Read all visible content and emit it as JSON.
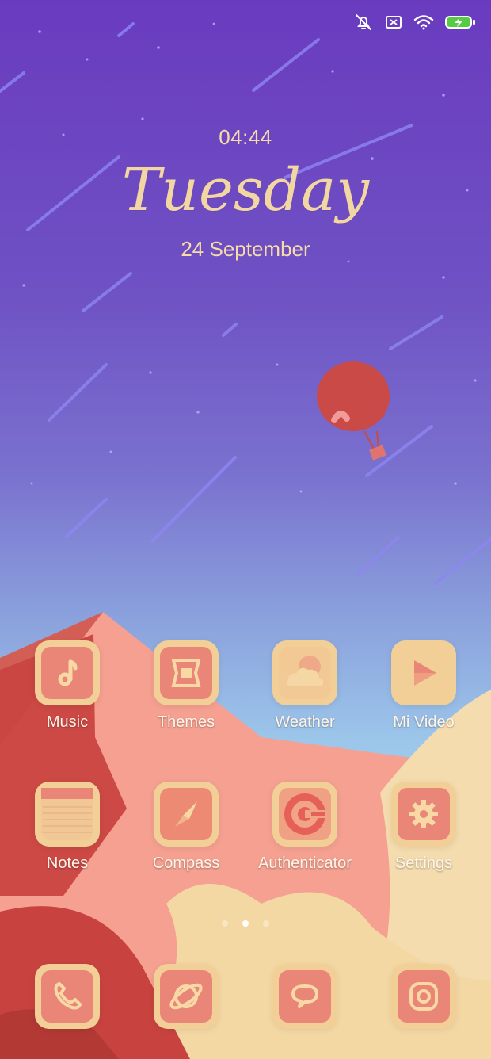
{
  "status_bar": {
    "icons": [
      "notifications-muted-icon",
      "no-sim-icon",
      "wifi-icon",
      "battery-charging-icon"
    ]
  },
  "lockclock": {
    "time": "04:44",
    "day": "Tuesday",
    "date": "24 September"
  },
  "apps": [
    {
      "label": "Music",
      "icon": "music-note-icon"
    },
    {
      "label": "Themes",
      "icon": "themes-icon"
    },
    {
      "label": "Weather",
      "icon": "weather-icon"
    },
    {
      "label": "Mi Video",
      "icon": "play-icon"
    },
    {
      "label": "Notes",
      "icon": "notes-icon"
    },
    {
      "label": "Compass",
      "icon": "compass-icon"
    },
    {
      "label": "Authenticator",
      "icon": "authenticator-icon"
    },
    {
      "label": "Settings",
      "icon": "gear-icon"
    }
  ],
  "dock": [
    {
      "icon": "phone-icon"
    },
    {
      "icon": "browser-planet-icon"
    },
    {
      "icon": "messages-icon"
    },
    {
      "icon": "camera-icon"
    }
  ],
  "page_indicator": {
    "count": 3,
    "active": 2
  },
  "colors": {
    "sky_top": "#6a3bbf",
    "sky_bottom": "#a9d8ef",
    "icon_tile": "#f3cf98",
    "icon_inner": "#e98678",
    "label": "#fff4e6",
    "clock": "#f7dca8"
  }
}
